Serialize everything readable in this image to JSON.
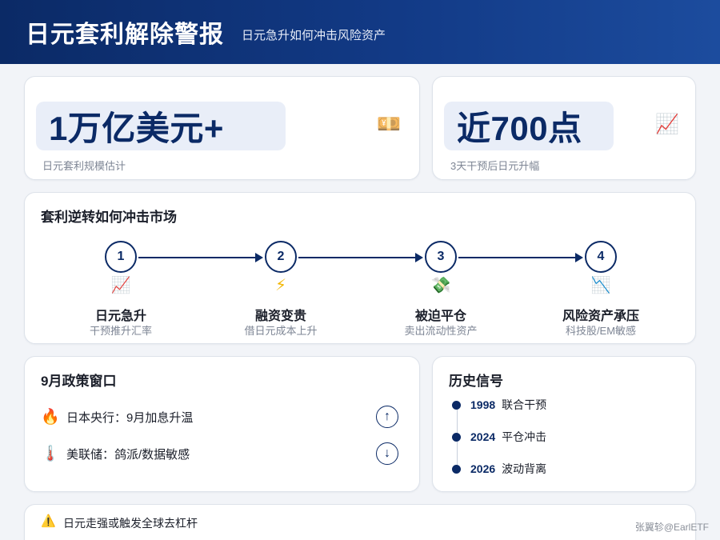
{
  "header": {
    "title": "日元套利解除警报",
    "subtitle": "日元急升如何冲击风险资产"
  },
  "stats": [
    {
      "value": "1万亿美元+",
      "label": "日元套利规模估计",
      "icon": "money-icon",
      "emoji": "💴"
    },
    {
      "value": "近700点",
      "label": "3天干预后日元升幅",
      "icon": "chart-up-icon",
      "emoji": "📈"
    }
  ],
  "flow": {
    "title": "套利逆转如何冲击市场",
    "steps": [
      {
        "num": "1",
        "emoji": "📈",
        "icon": "chart-up-icon",
        "title": "日元急升",
        "desc": "干预推升汇率"
      },
      {
        "num": "2",
        "emoji": "⚡",
        "icon": "lightning-icon",
        "title": "融资变贵",
        "desc": "借日元成本上升"
      },
      {
        "num": "3",
        "emoji": "💸",
        "icon": "money-wings-icon",
        "title": "被迫平仓",
        "desc": "卖出流动性资产"
      },
      {
        "num": "4",
        "emoji": "📉",
        "icon": "chart-down-icon",
        "title": "风险资产承压",
        "desc": "科技股/EM敏感"
      }
    ]
  },
  "policy": {
    "title": "9月政策窗口",
    "items": [
      {
        "emoji": "🔥",
        "icon": "fire-icon",
        "text": "日本央行：9月加息升温",
        "direction": "↑",
        "direction_icon": "arrow-up-icon"
      },
      {
        "emoji": "🌡️",
        "icon": "thermometer-icon",
        "text": "美联储：鸽派/数据敏感",
        "direction": "↓",
        "direction_icon": "arrow-down-icon"
      }
    ]
  },
  "history": {
    "title": "历史信号",
    "items": [
      {
        "year": "1998",
        "text": "联合干预"
      },
      {
        "year": "2024",
        "text": "平仓冲击"
      },
      {
        "year": "2026",
        "text": "波动背离"
      }
    ]
  },
  "warning": {
    "emoji": "⚠️",
    "icon": "warning-icon",
    "text": "日元走强或触发全球去杠杆"
  },
  "watermark": "张翼轸@EarlETF",
  "colors": {
    "brand": "#0b2a66",
    "accent_bg": "#e9eef8",
    "muted": "#7d8594"
  }
}
